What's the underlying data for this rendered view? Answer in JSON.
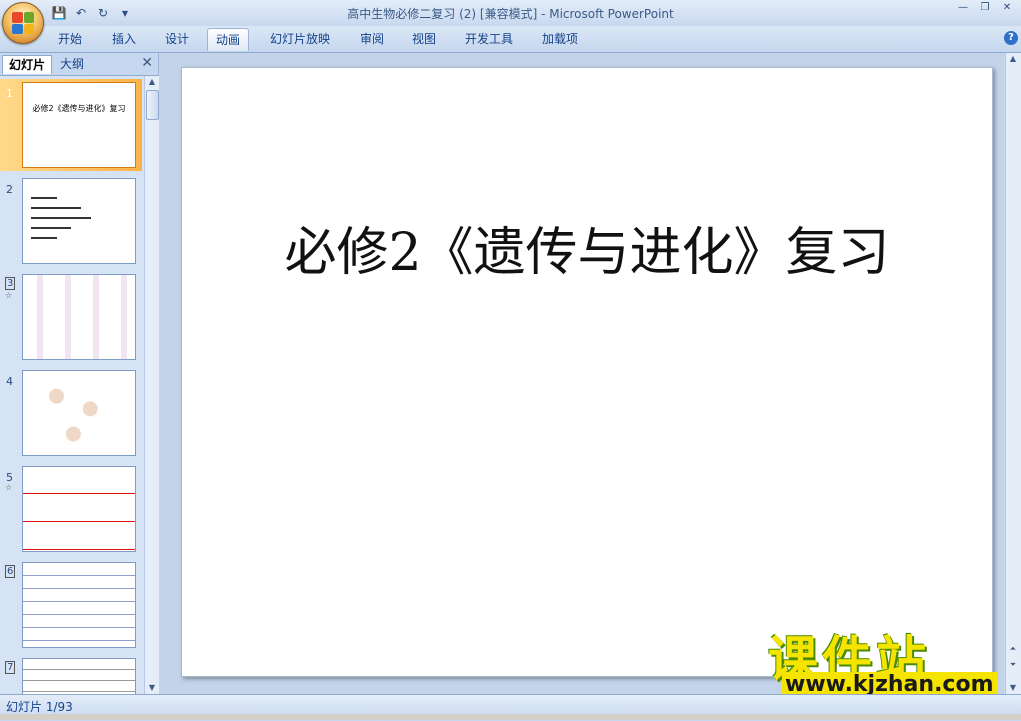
{
  "window": {
    "title": "高中生物必修二复习 (2) [兼容模式] - Microsoft PowerPoint"
  },
  "ribbon": {
    "tabs": [
      "开始",
      "插入",
      "设计",
      "动画",
      "幻灯片放映",
      "审阅",
      "视图",
      "开发工具",
      "加载项"
    ],
    "active_tab": "动画"
  },
  "left_pane": {
    "tabs": [
      "幻灯片",
      "大纲"
    ],
    "active_tab": "幻灯片"
  },
  "thumbnails": [
    {
      "number": "1",
      "title": "必修2《遗传与进化》复习",
      "selected": true
    },
    {
      "number": "2"
    },
    {
      "number": "3"
    },
    {
      "number": "4"
    },
    {
      "number": "5"
    },
    {
      "number": "6"
    },
    {
      "number": "7"
    }
  ],
  "slide": {
    "title": "必修2《遗传与进化》复习"
  },
  "watermark": {
    "brand": "课件站",
    "url": "www.kjzhan.com"
  },
  "status": {
    "slide_counter": "幻灯片 1/93"
  },
  "colors": {
    "accent": "#fbb24a",
    "ribbon_text": "#15428b",
    "watermark_yellow": "#f5e400"
  }
}
